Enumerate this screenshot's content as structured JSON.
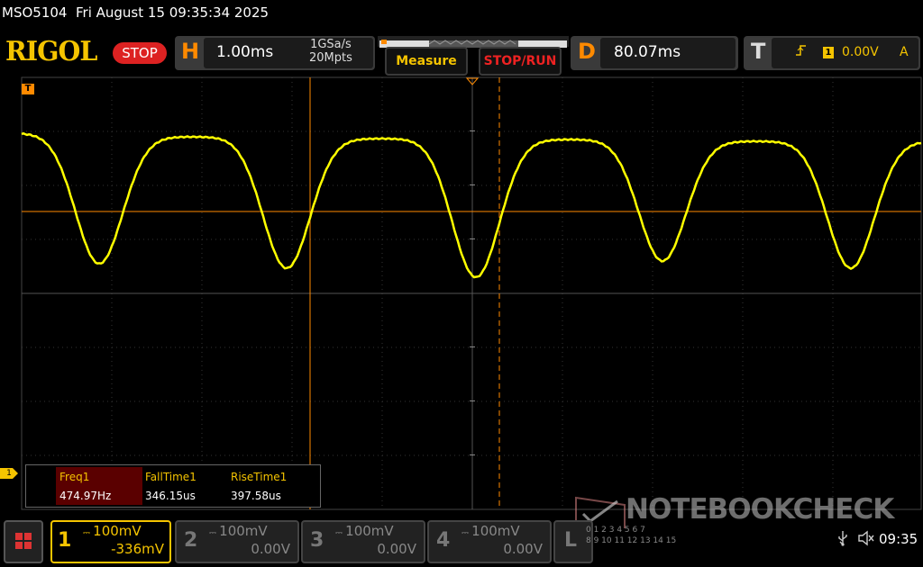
{
  "status_bar": {
    "model": "MSO5104",
    "datetime": "Fri August 15 09:35:34 2025"
  },
  "brand": {
    "logo": "RIGOL",
    "run_state": "STOP"
  },
  "horizontal": {
    "letter": "H",
    "timebase": "1.00ms",
    "sample_rate": "1GSa/s",
    "memory_depth": "20Mpts"
  },
  "buttons": {
    "measure": "Measure",
    "stop_run": "STOP/RUN"
  },
  "delay": {
    "letter": "D",
    "value": "80.07ms"
  },
  "trigger": {
    "letter": "T",
    "source": "1",
    "level": "0.00V",
    "mode": "A"
  },
  "markers": {
    "trigger_marker": "T",
    "ch1_marker": "1"
  },
  "measurements": [
    {
      "name": "Freq1",
      "value": "474.97Hz"
    },
    {
      "name": "FallTime1",
      "value": "346.15us"
    },
    {
      "name": "RiseTime1",
      "value": "397.58us"
    }
  ],
  "channels": [
    {
      "num": "1",
      "scale": "100mV",
      "offset": "-336mV",
      "active": true
    },
    {
      "num": "2",
      "scale": "100mV",
      "offset": "0.00V",
      "active": false
    },
    {
      "num": "3",
      "scale": "100mV",
      "offset": "0.00V",
      "active": false
    },
    {
      "num": "4",
      "scale": "100mV",
      "offset": "0.00V",
      "active": false
    }
  ],
  "logic": {
    "letter": "L",
    "bits_row1": "0 1 2 3 4 5 6 7",
    "bits_row2": "8 9 10 11 12 13 14 15"
  },
  "watermark": "NOTEBOOKCHECK",
  "system": {
    "clock": "09:35"
  },
  "colors": {
    "trace": "#ffff00",
    "accent": "#f5c400",
    "cursor": "#ff8a00",
    "stop": "#dd2222"
  },
  "icons": {
    "menu": "menu-grid-icon",
    "usb": "usb-icon",
    "speaker": "speaker-mute-icon",
    "trigger_edge": "rising-edge-icon"
  }
}
